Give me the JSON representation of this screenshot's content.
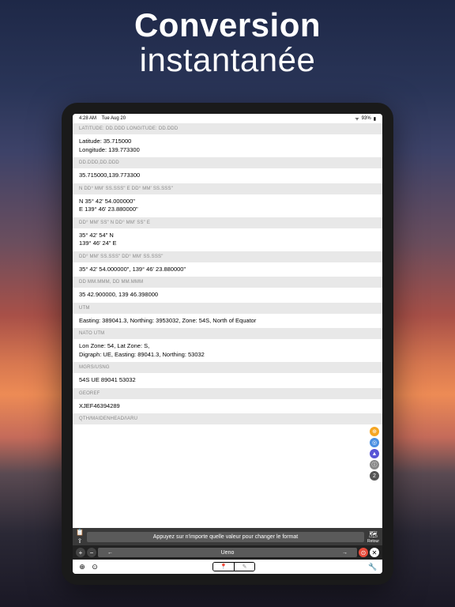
{
  "hero": {
    "line1": "Conversion",
    "line2": "instantanée"
  },
  "statusbar": {
    "time": "4:28 AM",
    "date": "Tue Aug 20",
    "wifi": "wifi-icon",
    "battery": "93%"
  },
  "sections": [
    {
      "header": "LATITUDE: DD.DDD LONGITUDE: DD.DDD",
      "lines": [
        "Latitude: 35.715000",
        "Longitude: 139.773300"
      ]
    },
    {
      "header": "DD.DDD,DD.DDD",
      "lines": [
        "35.715000,139.773300"
      ]
    },
    {
      "header": "N DD° MM' SS.SSS\" E DD° MM' SS.SSS\"",
      "lines": [
        "N 35° 42' 54.000000\"",
        "E 139° 46' 23.880000\""
      ]
    },
    {
      "header": "DD° MM' SS\" N DD° MM' SS\" E",
      "lines": [
        "35° 42' 54\" N",
        "139° 46' 24\" E"
      ]
    },
    {
      "header": "DD° MM' SS.SSS\" DD° MM' SS.SSS\"",
      "lines": [
        "35° 42' 54.000000\", 139° 46' 23.880000\""
      ]
    },
    {
      "header": "DD MM.MMM, DD MM.MMM",
      "lines": [
        "35 42.900000, 139 46.398000"
      ]
    },
    {
      "header": "UTM",
      "lines": [
        "Easting: 389041.3, Northing: 3953032, Zone: 54S, North of Equator"
      ]
    },
    {
      "header": "NATO UTM",
      "lines": [
        "Lon Zone: 54, Lat Zone: S,",
        " Digraph: UE, Easting: 89041.3, Northing: 53032"
      ]
    },
    {
      "header": "MGRS/USNG",
      "lines": [
        "54S UE 89041 53032"
      ]
    },
    {
      "header": "GEOREF",
      "lines": [
        "XJEF46394289"
      ]
    },
    {
      "header": "QTH/MAIDENHEAD/IARU",
      "lines": []
    }
  ],
  "side_icons": {
    "i1": "⊕",
    "i2": "◎",
    "i3": "▲",
    "i4": "ⓘ",
    "i5": "2"
  },
  "tip": {
    "text": "Appuyez sur n'importe quelle valeur pour changer le format",
    "copy": "📋",
    "share": "⇪",
    "map": "🗺",
    "back_label": "Retour"
  },
  "nav": {
    "plus": "+",
    "minus": "−",
    "left": "←",
    "right": "→",
    "location": "Ueno",
    "gps": "⊙",
    "close": "✕"
  },
  "bottom": {
    "zoom_in": "⊕",
    "center": "⊙",
    "pin": "📍",
    "edit": "✎",
    "wrench": "🔧"
  }
}
